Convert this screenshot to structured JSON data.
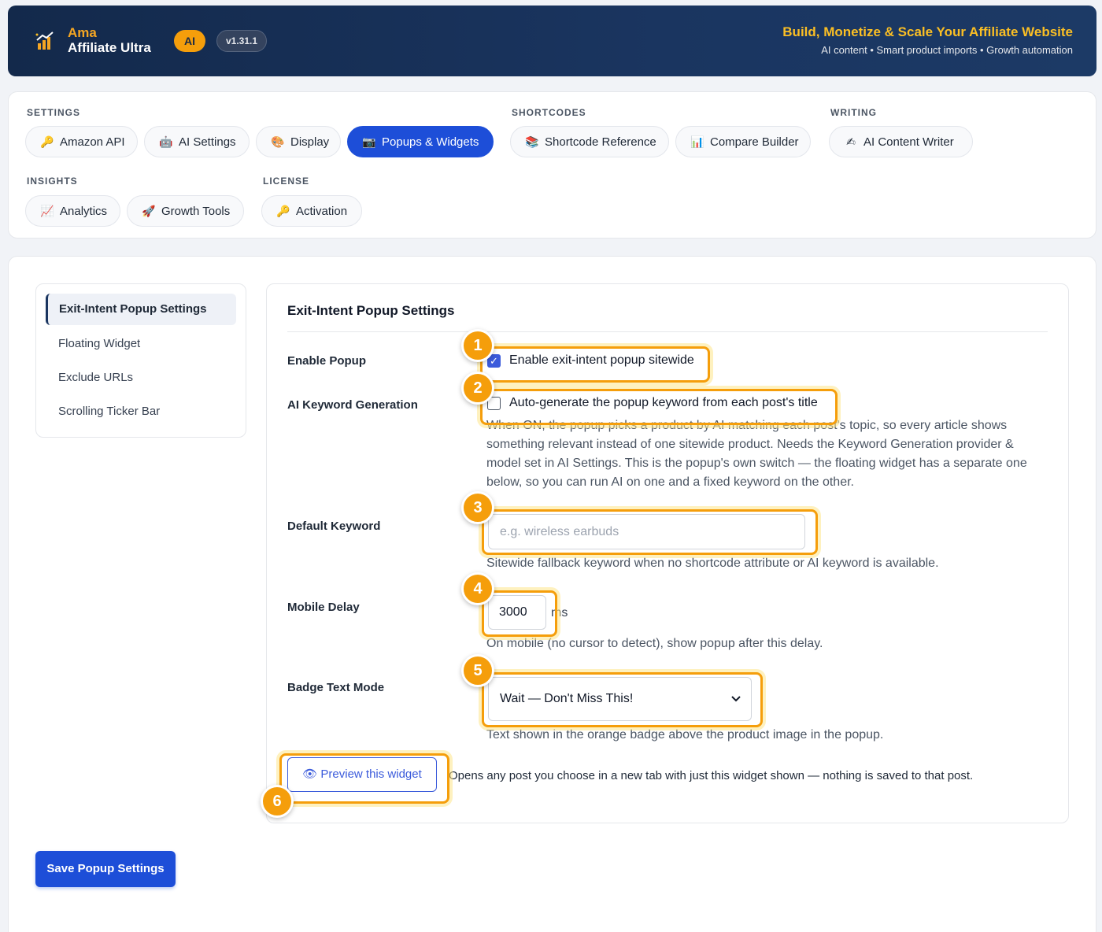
{
  "header": {
    "brand_top": "Ama",
    "brand_bottom": "Affiliate Ultra",
    "ai_badge": "AI",
    "version": "v1.31.1",
    "tagline": "Build, Monetize & Scale Your Affiliate Website",
    "subtagline": "AI content • Smart product imports • Growth automation"
  },
  "nav": {
    "groups": [
      {
        "label": "SETTINGS",
        "items": [
          {
            "label": "Amazon API",
            "icon": "key-icon"
          },
          {
            "label": "AI Settings",
            "icon": "robot-icon"
          },
          {
            "label": "Display",
            "icon": "palette-icon"
          },
          {
            "label": "Popups & Widgets",
            "icon": "camera-icon",
            "active": true
          }
        ]
      },
      {
        "label": "SHORTCODES",
        "items": [
          {
            "label": "Shortcode Reference",
            "icon": "books-icon"
          },
          {
            "label": "Compare Builder",
            "icon": "bar-chart-icon"
          }
        ]
      },
      {
        "label": "WRITING",
        "items": [
          {
            "label": "AI Content Writer",
            "icon": "writing-hand-icon"
          }
        ]
      },
      {
        "label": "INSIGHTS",
        "items": [
          {
            "label": "Analytics",
            "icon": "trend-chart-icon"
          },
          {
            "label": "Growth Tools",
            "icon": "rocket-icon"
          }
        ]
      },
      {
        "label": "LICENSE",
        "items": [
          {
            "label": "Activation",
            "icon": "key-icon"
          }
        ]
      }
    ]
  },
  "sidebar": {
    "items": [
      {
        "label": "Exit-Intent Popup Settings",
        "active": true
      },
      {
        "label": "Floating Widget"
      },
      {
        "label": "Exclude URLs"
      },
      {
        "label": "Scrolling Ticker Bar"
      }
    ]
  },
  "panel": {
    "title": "Exit-Intent Popup Settings",
    "enable_popup": {
      "label": "Enable Popup",
      "checkbox_label": "Enable exit-intent popup sitewide",
      "checked": true
    },
    "ai_keyword": {
      "label": "AI Keyword Generation",
      "checkbox_label": "Auto-generate the popup keyword from each post's title",
      "checked": false,
      "description": "When ON, the popup picks a product by AI matching each post's topic, so every article shows something relevant instead of one sitewide product. Needs the Keyword Generation provider & model set in AI Settings. This is the popup's own switch — the floating widget has a separate one below, so you can run AI on one and a fixed keyword on the other."
    },
    "default_keyword": {
      "label": "Default Keyword",
      "value": "",
      "placeholder": "e.g. wireless earbuds",
      "description": "Sitewide fallback keyword when no shortcode attribute or AI keyword is available."
    },
    "mobile_delay": {
      "label": "Mobile Delay",
      "value": "3000",
      "unit": "ms",
      "description": "On mobile (no cursor to detect), show popup after this delay."
    },
    "badge_text_mode": {
      "label": "Badge Text Mode",
      "selected": "Wait — Don't Miss This!",
      "description": "Text shown in the orange badge above the product image in the popup."
    },
    "preview": {
      "button_label": "👁 Preview this widget",
      "note": "Opens any post you choose in a new tab with just this widget shown — nothing is saved to that post."
    }
  },
  "annotations": [
    "1",
    "2",
    "3",
    "4",
    "5",
    "6"
  ],
  "save_button": "Save Popup Settings",
  "colors": {
    "header_bg": "#13294b",
    "accent_orange": "#f59e0b",
    "primary_blue": "#1d4ed8"
  }
}
